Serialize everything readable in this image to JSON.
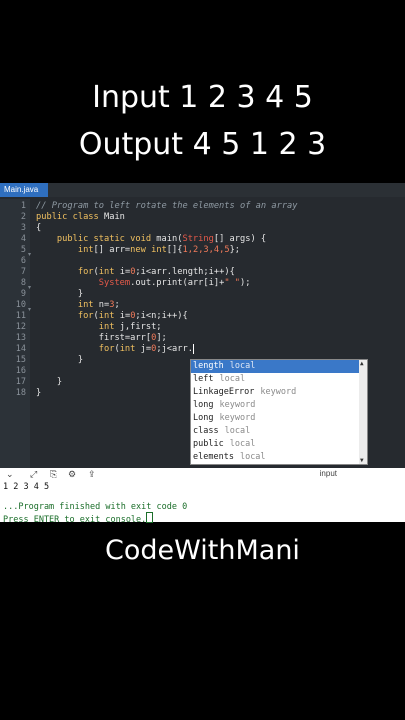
{
  "captions": {
    "line1": "Input 1 2 3 4 5",
    "line2": "Output 4 5 1 2 3",
    "brand": "CodeWithMani"
  },
  "editor": {
    "tab_label": "Main.java"
  },
  "line_numbers": [
    "1",
    "2",
    "3",
    "4",
    "5",
    "6",
    "7",
    "8",
    "9",
    "10",
    "11",
    "12",
    "13",
    "14",
    "15",
    "16",
    "17",
    "18"
  ],
  "code": {
    "l1": "// Program to left rotate the elements of an array",
    "l2_kw": "public class",
    "l2_name": " Main",
    "l3": "{",
    "l4_kw": "public static void",
    "l4_name": " main(",
    "l4_type": "String",
    "l4_rest": "[] args) {",
    "l5_type": "int",
    "l5_a": "[] arr=",
    "l5_kw": "new",
    "l5_type2": " int",
    "l5_b": "[]{",
    "l5_vals": "1,2,3,4,5",
    "l5_c": "};",
    "l7_kw": "for",
    "l7_a": "(",
    "l7_type": "int",
    "l7_b": " i=",
    "l7_n": "0",
    "l7_c": ";i<arr.length;i++){",
    "l8_sys": "System",
    "l8_a": ".out.print(arr[i]+",
    "l8_str": "\" \"",
    "l8_b": ");",
    "l9": "}",
    "l10_type": "int",
    "l10_a": " n=",
    "l10_n": "3",
    "l10_b": ";",
    "l11_kw": "for",
    "l11_a": "(",
    "l11_type": "int",
    "l11_b": " i=",
    "l11_n": "0",
    "l11_c": ";i<n;i++){",
    "l12_type": "int",
    "l12_a": " j,first;",
    "l13_a": "first=arr[",
    "l13_n": "0",
    "l13_b": "];",
    "l14_kw": "for",
    "l14_a": "(",
    "l14_type": "int",
    "l14_b": " j=",
    "l14_n": "0",
    "l14_c": ";j<arr.",
    "l15": "}",
    "l17": "}",
    "l18": "}"
  },
  "autocomplete": [
    {
      "name": "length",
      "kind": "local"
    },
    {
      "name": "left",
      "kind": "local"
    },
    {
      "name": "LinkageError",
      "kind": "keyword"
    },
    {
      "name": "long",
      "kind": "keyword"
    },
    {
      "name": "Long",
      "kind": "keyword"
    },
    {
      "name": "class",
      "kind": "local"
    },
    {
      "name": "public",
      "kind": "local"
    },
    {
      "name": "elements",
      "kind": "local"
    }
  ],
  "console": {
    "toolbar_label": "input",
    "output": "1 2 3 4 5",
    "finished": "...Program finished with exit code 0",
    "prompt": "Press ENTER to exit console."
  }
}
